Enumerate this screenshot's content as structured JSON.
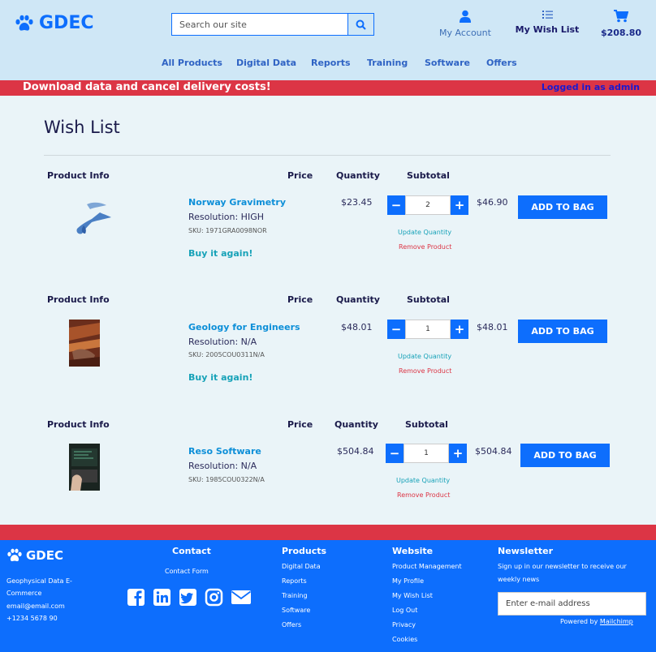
{
  "brand": {
    "name": "GDEC",
    "color": "#0d6efd"
  },
  "search": {
    "placeholder": "Search our site"
  },
  "header": {
    "account_label": "My Account",
    "wishlist_label": "My Wish List",
    "cart_total": "$208.80"
  },
  "nav": [
    "All Products",
    "Digital Data",
    "Reports",
    "Training",
    "Software",
    "Offers"
  ],
  "banner": {
    "message": "Download data and cancel delivery costs!",
    "login_status": "Logged in as admin",
    "color": "#dc3545"
  },
  "page_title": "Wish List",
  "columns": {
    "product_info": "Product Info",
    "price": "Price",
    "quantity": "Quantity",
    "subtotal": "Subtotal"
  },
  "items": [
    {
      "name": "Norway Gravimetry",
      "resolution": "Resolution: HIGH",
      "sku": "SKU: 1971GRA0098NOR",
      "buy_again": "Buy it again!",
      "price": "$23.45",
      "quantity": "2",
      "subtotal": "$46.90",
      "update_label": "Update Quantity",
      "remove_label": "Remove Product",
      "add_label": "ADD TO BAG"
    },
    {
      "name": "Geology for Engineers",
      "resolution": "Resolution: N/A",
      "sku": "SKU: 2005COU0311N/A",
      "buy_again": "Buy it again!",
      "price": "$48.01",
      "quantity": "1",
      "subtotal": "$48.01",
      "update_label": "Update Quantity",
      "remove_label": "Remove Product",
      "add_label": "ADD TO BAG"
    },
    {
      "name": "Reso Software",
      "resolution": "Resolution: N/A",
      "sku": "SKU: 1985COU0322N/A",
      "price": "$504.84",
      "quantity": "1",
      "subtotal": "$504.84",
      "update_label": "Update Quantity",
      "remove_label": "Remove Product",
      "add_label": "ADD TO BAG"
    }
  ],
  "footer": {
    "brand": "GDEC",
    "tagline_line1": "Geophysical Data E-",
    "tagline_line2": "Commerce",
    "email": "email@email.com",
    "phone": "+1234 5678 90",
    "contact_heading": "Contact",
    "contact_form": "Contact Form",
    "products_heading": "Products",
    "products_links": [
      "Digital Data",
      "Reports",
      "Training",
      "Software",
      "Offers"
    ],
    "website_heading": "Website",
    "website_links": [
      "Product Management",
      "My Profile",
      "My Wish List",
      "Log Out",
      "Privacy",
      "Cookies"
    ],
    "newsletter_heading": "Newsletter",
    "newsletter_text_line1": "Sign up in our newsletter to receive our",
    "newsletter_text_line2": "weekly news",
    "newsletter_placeholder": "Enter e-mail address",
    "powered_prefix": "Powered by",
    "powered_link": "Mailchimp",
    "social_icons": [
      "facebook-icon",
      "linkedin-icon",
      "twitter-icon",
      "instagram-icon",
      "envelope-icon"
    ]
  }
}
